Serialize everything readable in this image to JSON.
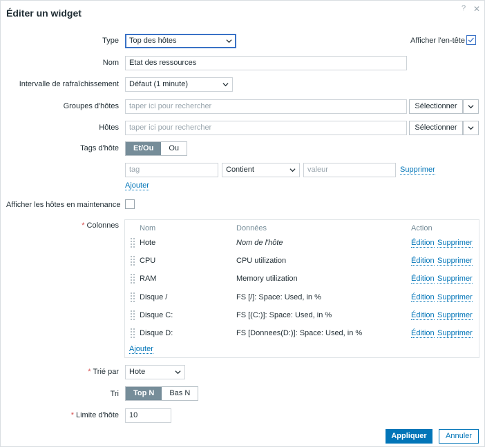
{
  "dialog": {
    "title": "Éditer un widget",
    "help_icon": "?",
    "close_icon": "✕"
  },
  "form": {
    "type": {
      "label": "Type",
      "value": "Top des hôtes"
    },
    "show_header": {
      "label": "Afficher l'en-tête",
      "checked": true
    },
    "name": {
      "label": "Nom",
      "value": "Etat des ressources"
    },
    "refresh": {
      "label": "Intervalle de rafraîchissement",
      "value": "Défaut (1 minute)"
    },
    "host_groups": {
      "label": "Groupes d'hôtes",
      "placeholder": "taper ici pour rechercher",
      "select_label": "Sélectionner"
    },
    "hosts": {
      "label": "Hôtes",
      "placeholder": "taper ici pour rechercher",
      "select_label": "Sélectionner"
    },
    "host_tags": {
      "label": "Tags d'hôte",
      "and_or": "Et/Ou",
      "or": "Ou",
      "tag_placeholder": "tag",
      "operator": "Contient",
      "value_placeholder": "valeur",
      "remove_label": "Supprimer",
      "add_label": "Ajouter"
    },
    "maintenance": {
      "label": "Afficher les hôtes en maintenance",
      "checked": false
    },
    "columns": {
      "label": "Colonnes",
      "required_mark": "*",
      "headers": {
        "name": "Nom",
        "data": "Données",
        "action": "Action"
      },
      "edit_label": "Édition",
      "remove_label": "Supprimer",
      "rows": [
        {
          "name": "Hote",
          "data": "Nom de l'hôte",
          "italic": true
        },
        {
          "name": "CPU",
          "data": "CPU utilization",
          "italic": false
        },
        {
          "name": "RAM",
          "data": "Memory utilization",
          "italic": false
        },
        {
          "name": "Disque /",
          "data": "FS [/]: Space: Used, in %",
          "italic": false
        },
        {
          "name": "Disque C:",
          "data": "FS [(C:)]: Space: Used, in %",
          "italic": false
        },
        {
          "name": "Disque D:",
          "data": "FS [Donnees(D:)]: Space: Used, in %",
          "italic": false
        }
      ],
      "add_label": "Ajouter"
    },
    "order_by": {
      "label": "Trié par",
      "required_mark": "*",
      "value": "Hote"
    },
    "order": {
      "label": "Tri",
      "top_n": "Top N",
      "bottom_n": "Bas N"
    },
    "host_limit": {
      "label": "Limite d'hôte",
      "required_mark": "*",
      "value": "10"
    }
  },
  "footer": {
    "apply": "Appliquer",
    "cancel": "Annuler"
  }
}
